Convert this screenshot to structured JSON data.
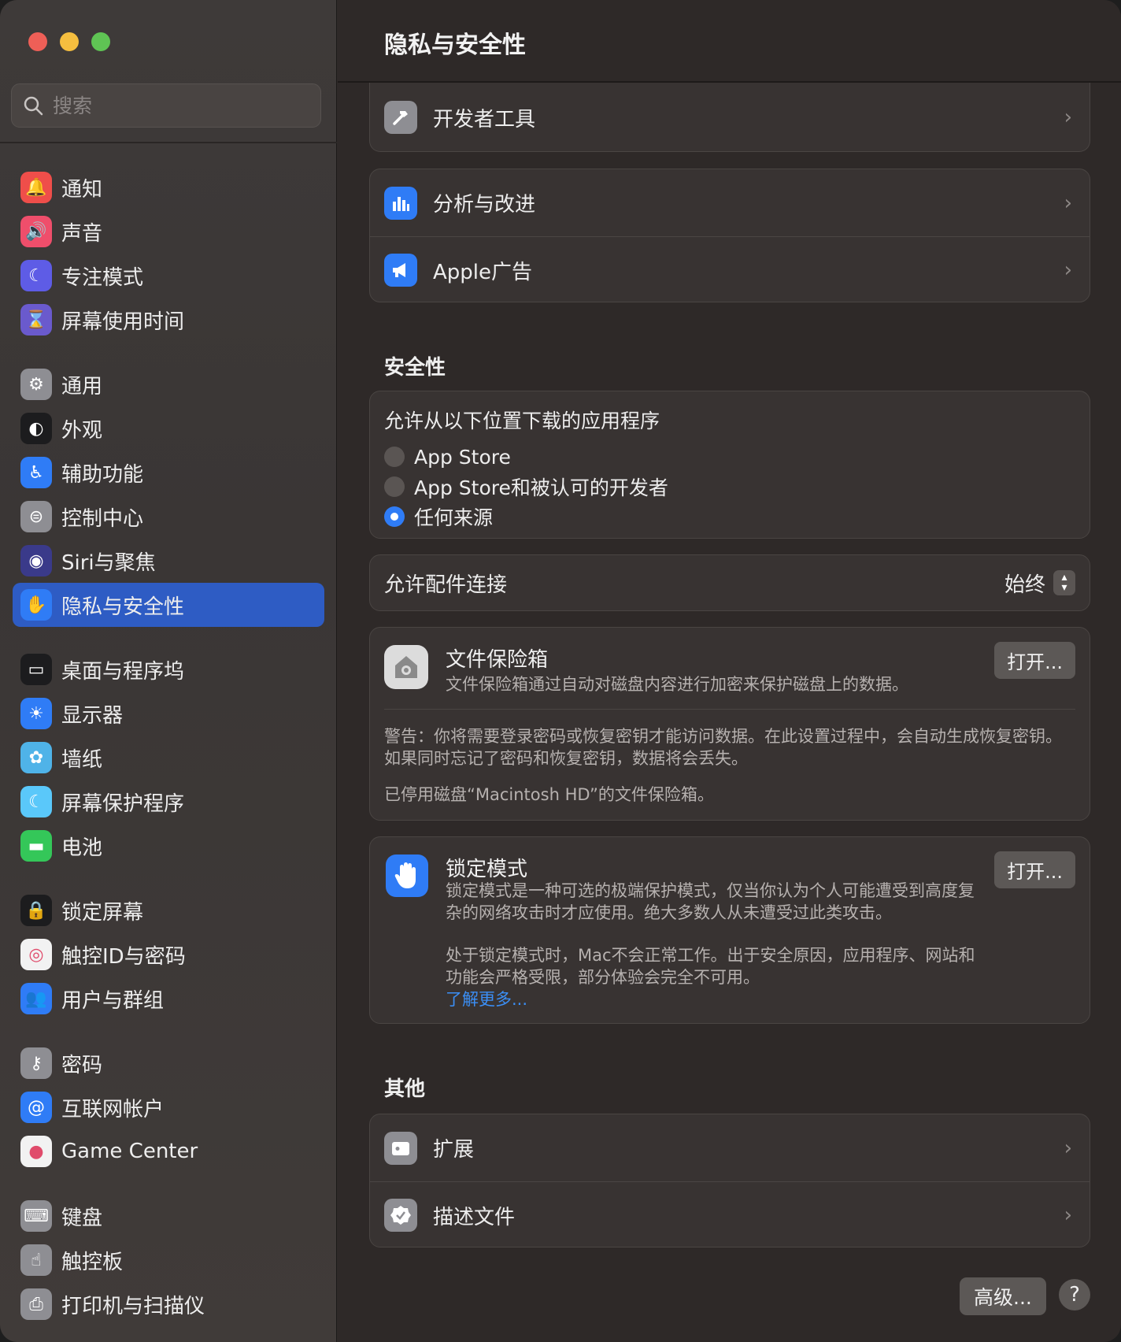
{
  "window": {
    "title": "隐私与安全性"
  },
  "search": {
    "placeholder": "搜索",
    "value": ""
  },
  "sidebar": {
    "groups": [
      [
        {
          "label": "通知",
          "icon": "bell-icon",
          "color": "#ef4e4a"
        },
        {
          "label": "声音",
          "icon": "speaker-icon",
          "color": "#ef4e6b"
        },
        {
          "label": "专注模式",
          "icon": "moon-icon",
          "color": "#5e5ce6"
        },
        {
          "label": "屏幕使用时间",
          "icon": "hourglass-icon",
          "color": "#6a5acd"
        }
      ],
      [
        {
          "label": "通用",
          "icon": "gear-icon",
          "color": "#8e8e93"
        },
        {
          "label": "外观",
          "icon": "appearance-icon",
          "color": "#1c1c1e"
        },
        {
          "label": "辅助功能",
          "icon": "accessibility-icon",
          "color": "#2f7cf6"
        },
        {
          "label": "控制中心",
          "icon": "toggle-icon",
          "color": "#8e8e93"
        },
        {
          "label": "Siri与聚焦",
          "icon": "siri-icon",
          "color": "#3a3a8a"
        },
        {
          "label": "隐私与安全性",
          "icon": "hand-icon",
          "color": "#2f7cf6",
          "active": true
        }
      ],
      [
        {
          "label": "桌面与程序坞",
          "icon": "dock-icon",
          "color": "#1c1c1e"
        },
        {
          "label": "显示器",
          "icon": "sun-icon",
          "color": "#2f7cf6"
        },
        {
          "label": "墙纸",
          "icon": "flower-icon",
          "color": "#4fb3e8"
        },
        {
          "label": "屏幕保护程序",
          "icon": "screensaver-icon",
          "color": "#5ac8fa"
        },
        {
          "label": "电池",
          "icon": "battery-icon",
          "color": "#34c759"
        }
      ],
      [
        {
          "label": "锁定屏幕",
          "icon": "lock-icon",
          "color": "#1c1c1e"
        },
        {
          "label": "触控ID与密码",
          "icon": "fingerprint-icon",
          "color": "#f2f2f2"
        },
        {
          "label": "用户与群组",
          "icon": "users-icon",
          "color": "#2f7cf6"
        }
      ],
      [
        {
          "label": "密码",
          "icon": "key-icon",
          "color": "#8e8e93"
        },
        {
          "label": "互联网帐户",
          "icon": "at-icon",
          "color": "#2f7cf6"
        },
        {
          "label": "Game Center",
          "icon": "game-center-icon",
          "color": "#f2f2f2"
        }
      ],
      [
        {
          "label": "键盘",
          "icon": "keyboard-icon",
          "color": "#8e8e93"
        },
        {
          "label": "触控板",
          "icon": "trackpad-icon",
          "color": "#8e8e93"
        },
        {
          "label": "打印机与扫描仪",
          "icon": "printer-icon",
          "color": "#8e8e93"
        }
      ]
    ]
  },
  "main": {
    "dev_tools": {
      "label": "开发者工具"
    },
    "analytics": {
      "label": "分析与改进"
    },
    "apple_ads": {
      "label": "Apple广告"
    },
    "security": {
      "title": "安全性",
      "download_question": "允许从以下位置下载的应用程序",
      "options": [
        "App Store",
        "App Store和被认可的开发者",
        "任何来源"
      ],
      "selected": "任何来源"
    },
    "accessory": {
      "label": "允许配件连接",
      "value": "始终"
    },
    "filevault": {
      "title": "文件保险箱",
      "description": "文件保险箱通过自动对磁盘内容进行加密来保护磁盘上的数据。",
      "button": "打开...",
      "warning": "警告：你将需要登录密码或恢复密钥才能访问数据。在此设置过程中，会自动生成恢复密钥。如果同时忘记了密码和恢复密钥，数据将会丢失。",
      "status": "已停用磁盘“Macintosh HD”的文件保险箱。"
    },
    "lockdown": {
      "title": "锁定模式",
      "description": "锁定模式是一种可选的极端保护模式，仅当你认为个人可能遭受到高度复杂的网络攻击时才应使用。绝大多数人从未遭受过此类攻击。",
      "detail": "处于锁定模式时，Mac不会正常工作。出于安全原因，应用程序、网站和功能会严格受限，部分体验会完全不可用。",
      "link": "了解更多...",
      "button": "打开..."
    },
    "other": {
      "title": "其他",
      "extensions": "扩展",
      "profiles": "描述文件"
    },
    "advanced_button": "高级...",
    "help_button": "?"
  }
}
